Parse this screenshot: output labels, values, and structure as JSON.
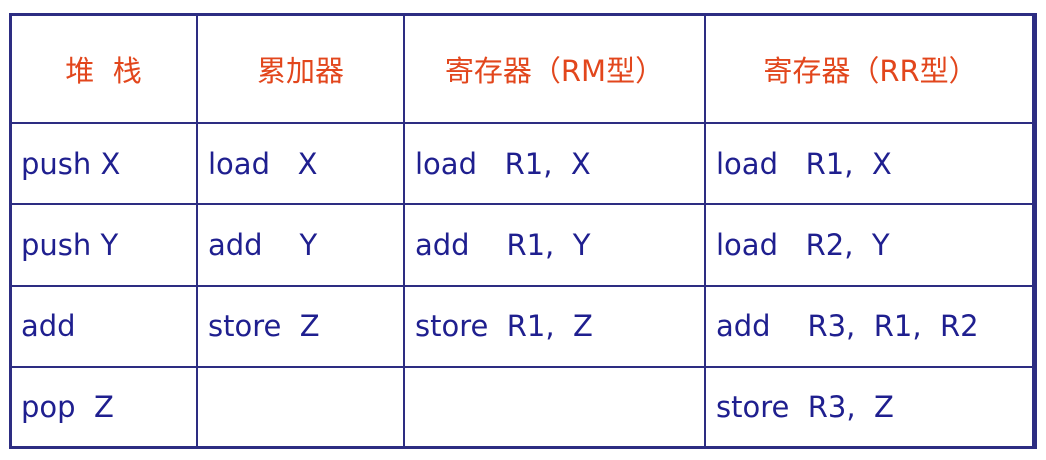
{
  "table": {
    "headers": [
      "堆  栈",
      "累加器",
      "寄存器（RM型）",
      "寄存器（RR型）"
    ],
    "rows": [
      [
        "push X",
        "load   X",
        "load   R1,  X",
        "load   R1,  X"
      ],
      [
        "push Y",
        "add    Y",
        "add    R1,  Y",
        "load   R2,  Y"
      ],
      [
        "add",
        "store  Z",
        "store  R1,  Z",
        "add    R3,  R1,  R2"
      ],
      [
        "pop  Z",
        "",
        "",
        "store  R3,  Z"
      ]
    ]
  },
  "colors": {
    "header_text": "#e2461c",
    "body_text": "#1f1f8f",
    "border": "#2d2d82"
  }
}
